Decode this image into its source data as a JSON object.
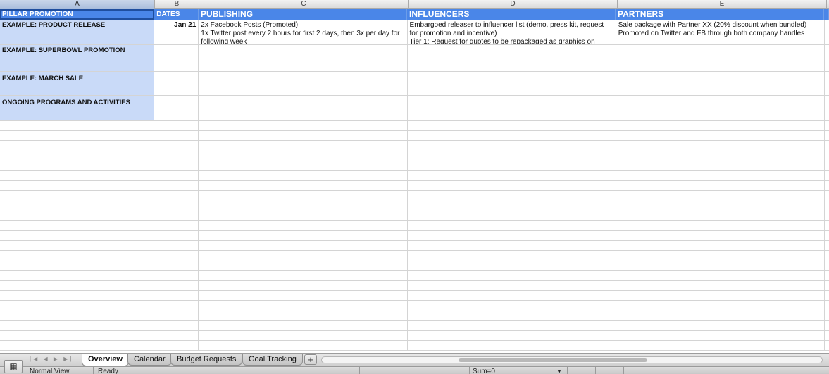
{
  "columns": [
    "A",
    "B",
    "C",
    "D",
    "E"
  ],
  "header": {
    "a": "PILLAR PROMOTION",
    "b": "DATES",
    "c": "PUBLISHING",
    "d": "INFLUENCERS",
    "e": "PARTNERS"
  },
  "rows": [
    {
      "a": "EXAMPLE: PRODUCT RELEASE",
      "b": "Jan 21",
      "c": "2x Facebook Posts (Promoted)\n1x Twitter post every 2 hours for first 2 days, then 3x per day for following week",
      "d": "Embargoed releaser to influencer list (demo, press kit, request for promotion and incentive)\nTier 1: Request for quotes to be repackaged as graphics on",
      "e": "Sale package with Partner XX (20% discount when bundled)\nPromoted on Twitter and FB through both company handles"
    },
    {
      "a": "EXAMPLE: SUPERBOWL PROMOTION",
      "b": "",
      "c": "",
      "d": "",
      "e": ""
    },
    {
      "a": "EXAMPLE: MARCH SALE",
      "b": "",
      "c": "",
      "d": "",
      "e": ""
    },
    {
      "a": "ONGOING PROGRAMS AND ACTIVITIES",
      "b": "",
      "c": "",
      "d": "",
      "e": ""
    }
  ],
  "sheet_tabs": {
    "overview": "Overview",
    "calendar": "Calendar",
    "budget_requests": "Budget Requests",
    "goal_tracking": "Goal Tracking",
    "add": "+"
  },
  "status": {
    "view": "Normal View",
    "state": "Ready",
    "sum": "Sum=0"
  },
  "colors": {
    "header_fill": "#4a86e8",
    "pillar_fill": "#c9daf8"
  },
  "icons": {
    "view_toggle": "grid-view-icon",
    "sheet_nav": "sheet-nav-arrows-icon",
    "sum_dropdown": "chevron-down-icon"
  }
}
